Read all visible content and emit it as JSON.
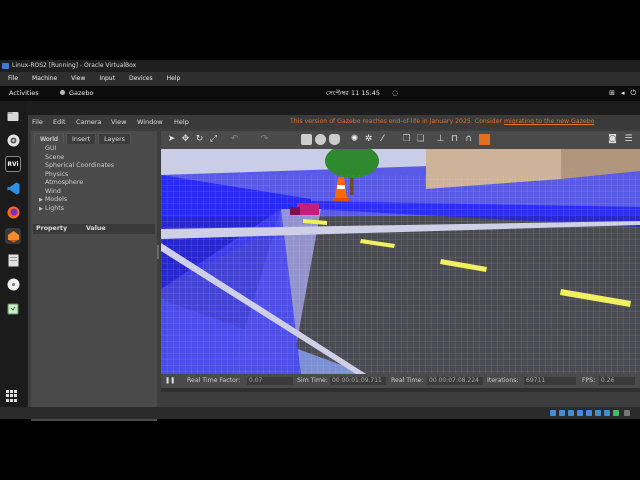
{
  "vbox": {
    "title": "Linux-ROS2 [Running] - Oracle VirtualBox",
    "menu": [
      "File",
      "Machine",
      "View",
      "Input",
      "Devices",
      "Help"
    ]
  },
  "desktop": {
    "activities": "Activities",
    "app_name": "Gazebo",
    "clock": "সেপ্টেম্বর 11  15:45"
  },
  "dock": {
    "icons": [
      "files-icon",
      "disc-icon",
      "rviz-icon",
      "vscode-icon",
      "firefox-icon",
      "gazebo-icon",
      "document-icon",
      "disc-drive-icon",
      "trash-icon"
    ]
  },
  "gazebo": {
    "menu": [
      "File",
      "Edit",
      "Camera",
      "View",
      "Window",
      "Help"
    ],
    "eol_notice": "This version of Gazebo reaches end-of-life in January 2025. Consider",
    "eol_link": "migrating to the new Gazebo",
    "tabs": [
      "World",
      "Insert",
      "Layers"
    ],
    "tree": [
      "GUI",
      "Scene",
      "Spherical Coordinates",
      "Physics",
      "Atmosphere",
      "Wind",
      "Models",
      "Lights"
    ],
    "property_header": [
      "Property",
      "Value"
    ],
    "status": {
      "rtf_label": "Real Time Factor:",
      "rtf_value": "0.07",
      "sim_label": "Sim Time:",
      "sim_value": "00 00:01:09.711",
      "real_label": "Real Time:",
      "real_value": "00 00:07:08.224",
      "iter_label": "Iterations:",
      "iter_value": "69711",
      "fps_label": "FPS:",
      "fps_value": "0.26"
    }
  },
  "colors": {
    "eol": "#e06f2c",
    "laser": "#1a1aff",
    "road": "#4b4b52",
    "lane_marking": "#f0f060"
  }
}
